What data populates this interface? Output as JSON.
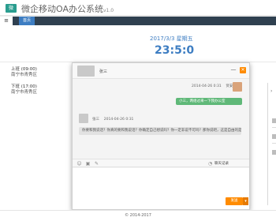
{
  "header": {
    "logo_text": "微",
    "title": "微企移动OA办公系统",
    "version": "v1.0"
  },
  "tabs": {
    "toggle": "≡",
    "home_label": "首页"
  },
  "dashboard": {
    "date_text": "2017/3/3 星期五",
    "clock": "23:5:0",
    "clock_in": {
      "label": "上班 (09:00)",
      "location": "南宁市青秀区"
    },
    "clock_out": {
      "label": "下班 (17:00)",
      "location": "南宁市青秀区"
    }
  },
  "chat": {
    "contact_name": "张三",
    "minimize": "—",
    "close": "✕",
    "messages": [
      {
        "side": "right",
        "time": "2014-04-26 0:31",
        "sender": "贤安",
        "text": "小三，两组过来一下我办公室"
      },
      {
        "side": "left",
        "sender": "张三",
        "time": "2014-04-26 0:31",
        "text": "你要和我说话？你真的要和我说话？你确定自己想说吗？你一定非说不可吗？那你说吧，这是自由的是"
      }
    ],
    "toolbar": {
      "emoji": "☺",
      "image": "▣",
      "file": "✎",
      "history_label": "聊天记录"
    },
    "send_label": "发送",
    "send_dropdown": "▾"
  },
  "sidepanel": {
    "scroll_arrow": "›"
  },
  "footer": {
    "copyright": "© 2014-2017"
  }
}
